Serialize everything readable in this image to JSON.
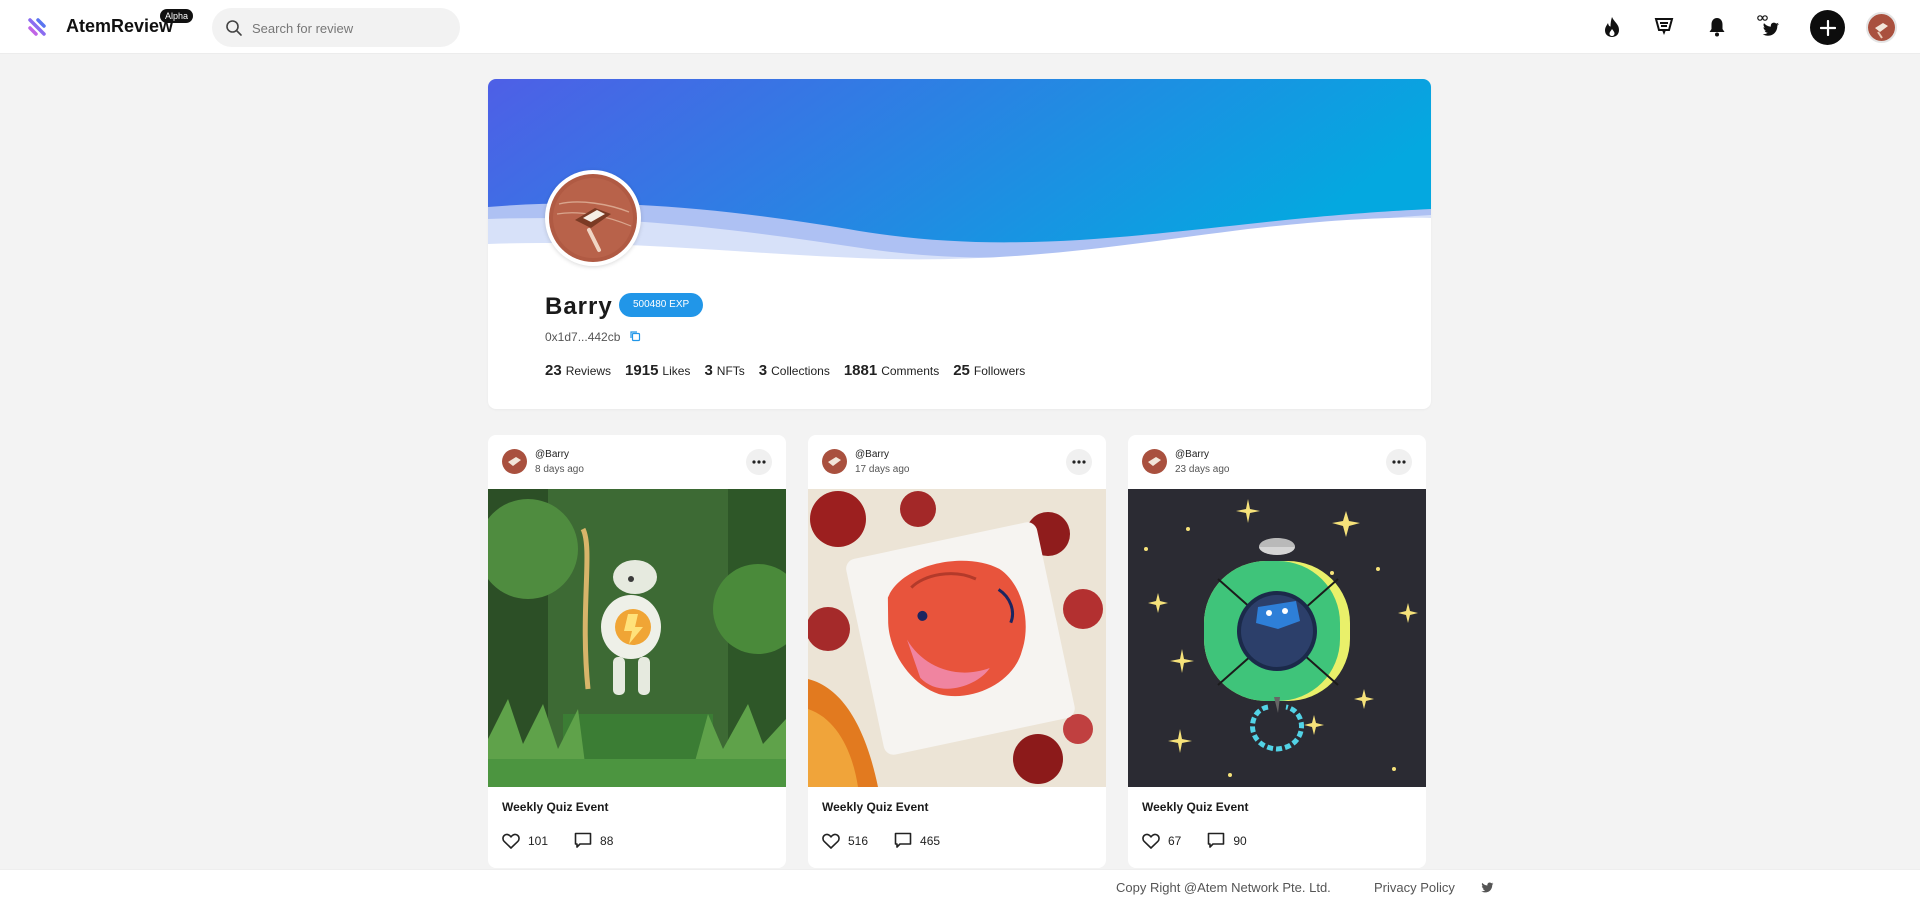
{
  "header": {
    "brand": "AtemReview",
    "badge": "Alpha",
    "search_placeholder": "Search for review",
    "icons": [
      "flame-icon",
      "trophy-icon",
      "bell-icon",
      "twitter-link-icon",
      "plus-icon",
      "avatar"
    ]
  },
  "profile": {
    "name": "Barry",
    "exp": "500480 EXP",
    "address": "0x1d7...442cb",
    "stats": [
      {
        "value": "23",
        "label": "Reviews"
      },
      {
        "value": "1915",
        "label": "Likes"
      },
      {
        "value": "3",
        "label": "NFTs"
      },
      {
        "value": "3",
        "label": "Collections"
      },
      {
        "value": "1881",
        "label": "Comments"
      },
      {
        "value": "25",
        "label": "Followers"
      }
    ],
    "banner_colors": [
      "#4e5fe6",
      "#1aa3e4"
    ]
  },
  "posts": [
    {
      "user": "@Barry",
      "time": "8 days ago",
      "title": "Weekly Quiz Event",
      "likes": "101",
      "comments": "88"
    },
    {
      "user": "@Barry",
      "time": "17 days ago",
      "title": "Weekly Quiz Event",
      "likes": "516",
      "comments": "465"
    },
    {
      "user": "@Barry",
      "time": "23 days ago",
      "title": "Weekly Quiz Event",
      "likes": "67",
      "comments": "90"
    }
  ],
  "footer": {
    "copyright": "Copy Right @Atem Network Pte. Ltd.",
    "privacy": "Privacy Policy"
  }
}
